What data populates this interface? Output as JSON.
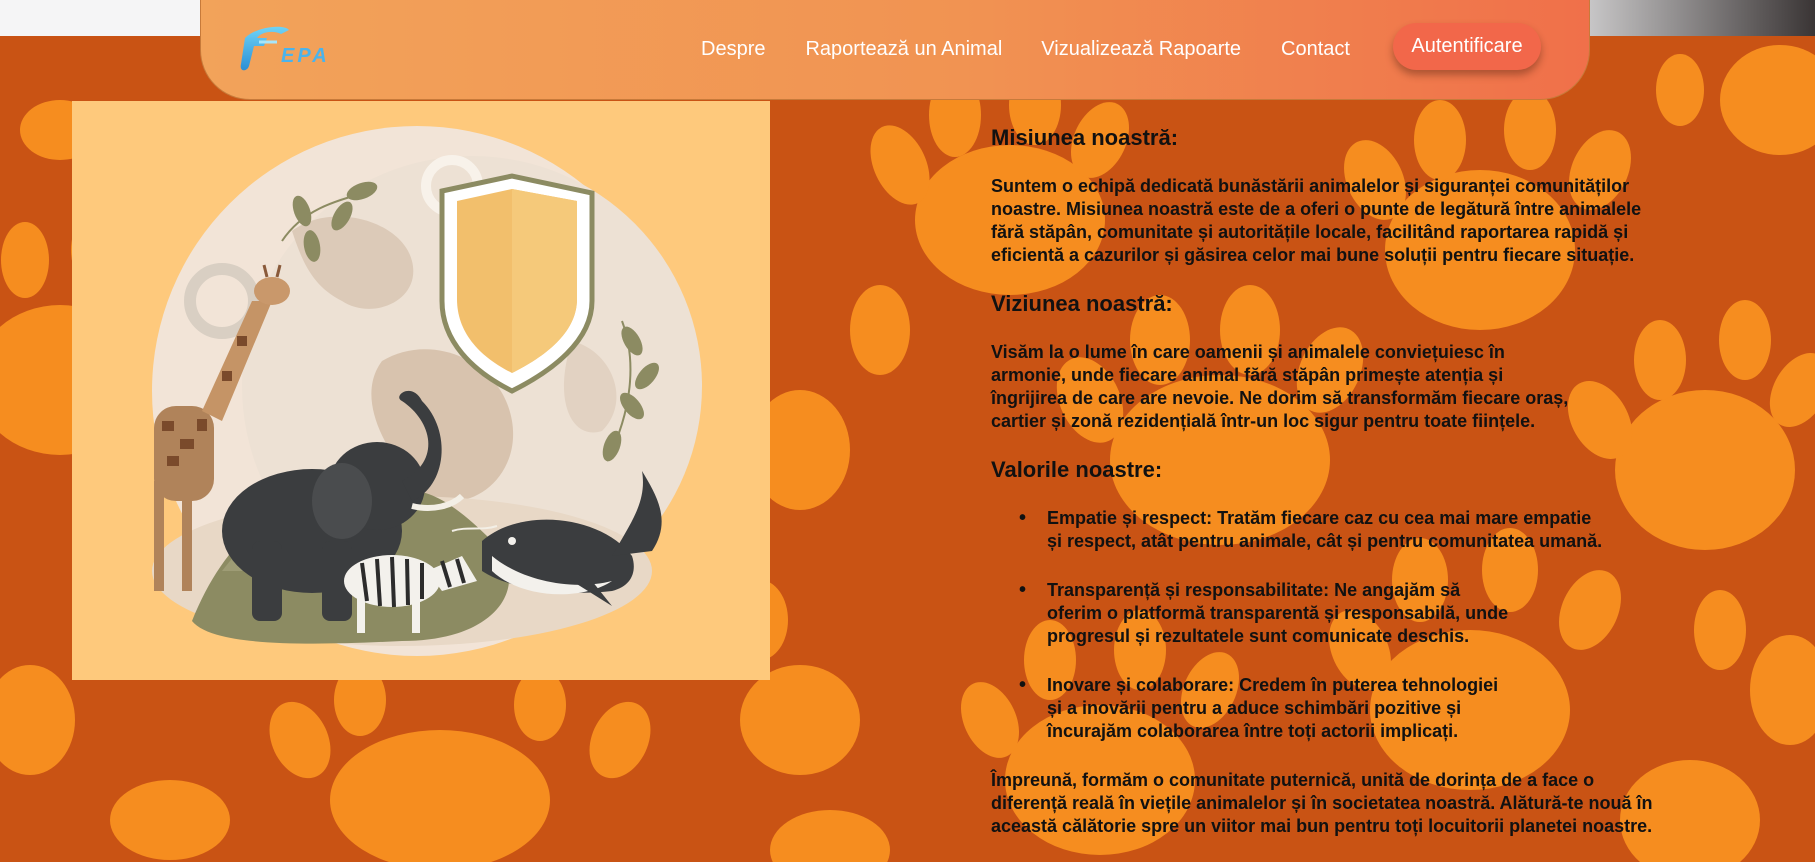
{
  "header": {
    "logo_text": "FEPA",
    "nav": [
      {
        "label": "Despre"
      },
      {
        "label": "Raportează un Animal"
      },
      {
        "label": "Vizualizează Rapoarte"
      },
      {
        "label": "Contact"
      }
    ],
    "login_label": "Autentificare"
  },
  "colors": {
    "background": "#c95314",
    "paw": "#f68d1f",
    "navbar_start": "#f2a35a",
    "navbar_end": "#f0704a",
    "button": "#f2674a",
    "illustration_bg": "#fec97c"
  },
  "illustration": {
    "subjects": [
      "giraffe",
      "elephant",
      "zebra",
      "whale",
      "shield",
      "globe",
      "gears",
      "leaves"
    ]
  },
  "about": {
    "mission": {
      "title": "Misiunea noastră:",
      "lines": [
        "Suntem o echipă dedicată bunăstării animalelor și siguranței comunităților",
        "noastre. Misiunea noastră este de a oferi o punte de legătură între animalele",
        "fără stăpân, comunitate și autoritățile locale, facilitând raportarea rapidă și",
        "eficientă a cazurilor și găsirea celor mai bune soluții pentru fiecare situație."
      ]
    },
    "vision": {
      "title": "Viziunea noastră:",
      "lines": [
        "Visăm la o lume în care oamenii și animalele conviețuiesc în",
        "armonie, unde fiecare animal fără stăpân primește atenția și",
        "îngrijirea de care are nevoie. Ne dorim să transformăm fiecare oraș,",
        "cartier și zonă rezidențială într-un loc sigur pentru toate ființele."
      ]
    },
    "values": {
      "title": "Valorile noastre:",
      "items": [
        {
          "lines": [
            "Empatie și respect: Tratăm fiecare caz cu cea mai mare empatie",
            "și respect, atât pentru animale, cât și pentru comunitatea umană."
          ]
        },
        {
          "lines": [
            "Transparență și responsabilitate: Ne angajăm să",
            "oferim o platformă transparentă și responsabilă, unde",
            "progresul și rezultatele sunt comunicate deschis."
          ]
        },
        {
          "lines": [
            "Inovare și colaborare: Credem în puterea tehnologiei",
            "și a inovării pentru a aduce schimbări pozitive și",
            "încurajăm colaborarea între toți actorii implicați."
          ]
        }
      ]
    },
    "closing": {
      "lines": [
        "Împreună, formăm o comunitate puternică, unită de dorința de a face o",
        "diferență reală în viețile animalelor și în societatea noastră. Alătură-te nouă în",
        "această călătorie spre un viitor mai bun pentru toți locuitorii planetei noastre."
      ]
    }
  }
}
